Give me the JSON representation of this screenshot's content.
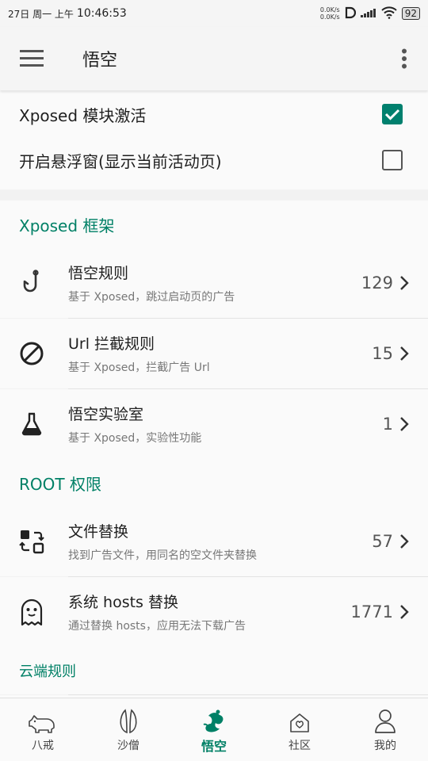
{
  "status": {
    "date": "27日 周一 上午",
    "time": "10:46:53",
    "speed_up": "0.0K/s",
    "speed_down": "0.0K/s",
    "battery": "92"
  },
  "appbar": {
    "title": "悟空"
  },
  "toggles": [
    {
      "label": "Xposed 模块激活",
      "checked": true
    },
    {
      "label": "开启悬浮窗(显示当前活动页)",
      "checked": false
    }
  ],
  "sections": {
    "xposed": {
      "title": "Xposed 框架",
      "items": [
        {
          "title": "悟空规则",
          "subtitle": "基于 Xposed，跳过启动页的广告",
          "count": "129",
          "icon": "hook-icon"
        },
        {
          "title": "Url 拦截规则",
          "subtitle": "基于 Xposed，拦截广告 Url",
          "count": "15",
          "icon": "block-icon"
        },
        {
          "title": "悟空实验室",
          "subtitle": "基于 Xposed，实验性功能",
          "count": "1",
          "icon": "flask-icon"
        }
      ]
    },
    "root": {
      "title": "ROOT 权限",
      "items": [
        {
          "title": "文件替换",
          "subtitle": "找到广告文件，用同名的空文件夹替换",
          "count": "57",
          "icon": "swap-icon"
        },
        {
          "title": "系统 hosts 替换",
          "subtitle": "通过替换 hosts，应用无法下载广告",
          "count": "1771",
          "icon": "ghost-icon"
        }
      ]
    },
    "cloud": {
      "title": "云端规则"
    }
  },
  "nav": [
    {
      "label": "八戒",
      "icon": "pig-icon",
      "active": false
    },
    {
      "label": "沙僧",
      "icon": "leaf-icon",
      "active": false
    },
    {
      "label": "悟空",
      "icon": "monkey-icon",
      "active": true
    },
    {
      "label": "社区",
      "icon": "community-icon",
      "active": false
    },
    {
      "label": "我的",
      "icon": "person-icon",
      "active": false
    }
  ],
  "colors": {
    "accent": "#008066",
    "checkbox": "#00806e"
  }
}
